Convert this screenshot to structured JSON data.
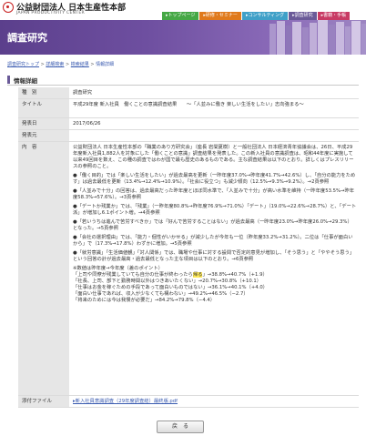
{
  "header": {
    "org_name": "公益財団法人 日本生産性本部",
    "org_en": "JAPAN PRODUCTIVITY CENTER",
    "nav": [
      {
        "label": "▸トップページ",
        "color": "#45a845"
      },
      {
        "label": "▸研修・セミナー",
        "color": "#e07a1c"
      },
      {
        "label": "▸コンサルティング",
        "color": "#3fa0c8"
      },
      {
        "label": "▸調査研究",
        "color": "#6a5a98"
      },
      {
        "label": "▸書籍・手帳",
        "color": "#c83a64"
      }
    ]
  },
  "banner": {
    "title": "調査研究"
  },
  "breadcrumb": [
    "調査研究トップ",
    "詳細検索",
    "検索結果",
    "情報詳細"
  ],
  "section": {
    "title": "情報詳細"
  },
  "rows": {
    "category": {
      "label": "種　別",
      "value": "調査研究"
    },
    "title": {
      "label": "タイトル",
      "value": "平成29年度 新入社員　働くことの意識調査結果　　～「人並みに働き 楽しい生活をしたい」志向強まる～"
    },
    "date": {
      "label": "発表日",
      "value": "2017/06/26"
    },
    "source": {
      "label": "発表元",
      "value": ""
    },
    "content": {
      "label": "内　容",
      "intro": "公益財団法人 日本生産性本部の「職業のあり方研究会」（座長 岩間夏樹）と一般社団法人 日本経済青年協議会は、26日、平成29年度新入社員1,882人を対象にした「働くことの意識」調査結果を発表した。この新入社員の意識調査は、昭和44年度に実施して以来49回目を数え、この種の調査ではわが国で最も歴史のあるものである。主な調査結果は以下のとおり。詳しくはプレスリリースの参照のこと。",
      "b1": "●「働く目的」では「楽しい生活をしたい」が過去最高を更新（一昨年度37.0%→昨年度41.7%→42.6%）し、「自分の能力をためす」は過去最低を更新（13.4%→12.4%→10.9%）。「社会に役立つ」も減少傾向（12.5%→9.3%→9.2%）。→2頁参照",
      "b2": "●「人並みで十分」の回答は、過去最高だった昨年度とほぼ同水準で、「人並みで十分」が高い水準を維持（一昨年度53.5%→昨年度58.3%→57.6%）。→3頁参照",
      "b3": "●「デートか残業か」では、「残業」（一昨年度80.8%→昨年度76.9%→71.0%）「デート」（19.0%→22.6%→28.7%）と、「デート派」が増加し6.1ポイント増。→4頁参照",
      "b4": "●「若いうちは進んで苦労すべきか」では「好んで苦労することはない」が過去最高（一昨年度23.0%→昨年度26.0%→29.3%）となった。→5頁参照",
      "b5": "●「会社の選択理由」では、「能力・個性がいかせる」が減少したが今年も一位（昨年度33.2%→31.2%）。二位は「仕事が面白いから」で（17.3%→17.8%）わずかに増加。→5頁参照",
      "b6": "●「就労意識」「生活価値観」「対人関係」では、職場や仕事に対する設問で否定的意見が増加し、「そう思う」と「ややそう思う」という回答の計が過去最高・過去最低となった主な項目は以下のとおり。→6頁参照",
      "list_head": "※数値は昨年度→今年度（差のポイント）",
      "list": [
        {
          "pre": "「上司や同僚が残業していても自分の仕事が終わったら",
          "hl": "帰る",
          "post": "」→38.8%→40.7%（+1.9）"
        },
        {
          "pre": "「社長、上司、部下と勤務時間以外はつきあいたくない」→20.7%→30.8%（+10.1）",
          "hl": "",
          "post": ""
        },
        {
          "pre": "「仕事はお金を稼ぐための手段であって面白いものではない」→36.1%→40.1%（+4.0）",
          "hl": "",
          "post": ""
        },
        {
          "pre": "「面白い仕事であれば、収入が少なくても構わない」→49.2%→46.5%（−2.7）",
          "hl": "",
          "post": ""
        },
        {
          "pre": "「将来のためには今は我慢が必要だ」→84.2%→79.8%（−4.4）",
          "hl": "",
          "post": ""
        }
      ]
    },
    "attachment": {
      "label": "添付ファイル",
      "link": "▸新入社員意識調査（29年度調査結）最終版.pdf"
    }
  },
  "back_button": {
    "label": "戻　る"
  }
}
